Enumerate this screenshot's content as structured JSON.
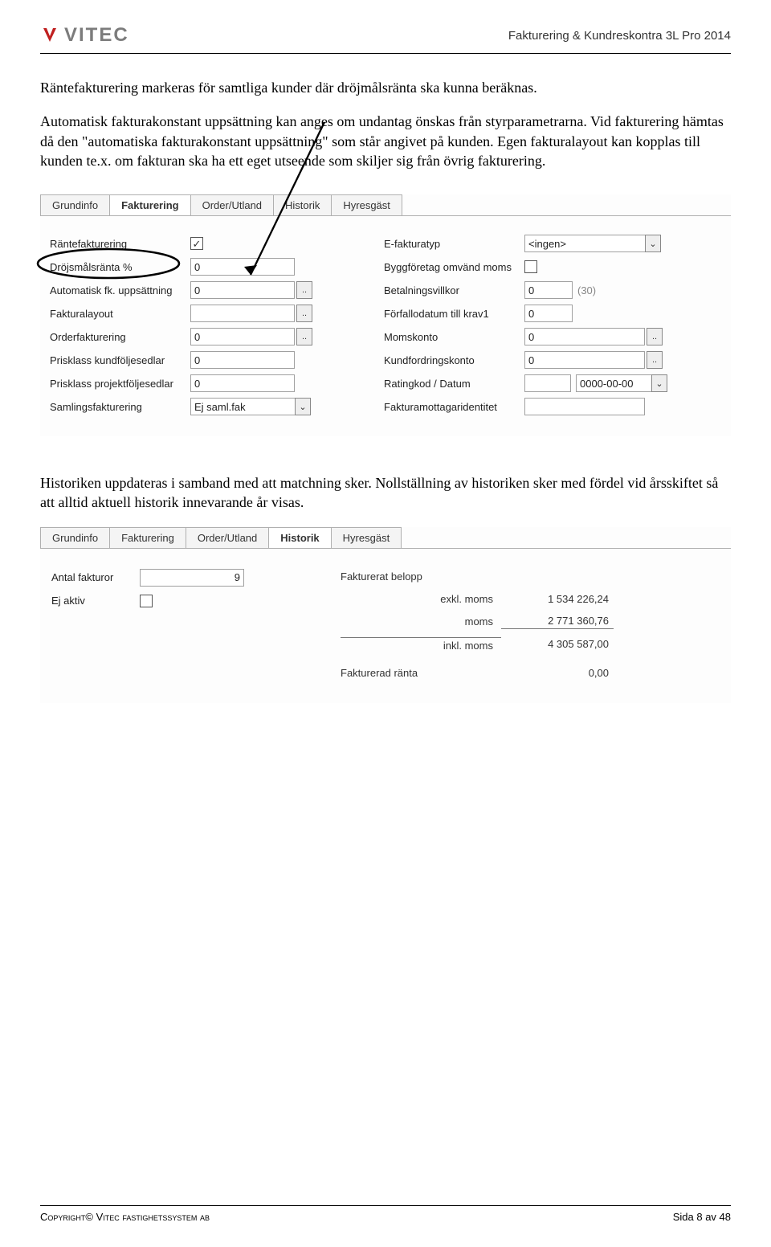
{
  "header": {
    "logo_text": "VITEC",
    "doc_title": "Fakturering & Kundreskontra 3L Pro 2014"
  },
  "para1": "Räntefakturering markeras för samtliga kunder där dröjmålsränta ska kunna beräknas.",
  "para2": "Automatisk fakturakonstant uppsättning kan anges om undantag önskas från styrparametrarna. Vid fakturering hämtas då den \"automatiska fakturakonstant uppsättning\" som står angivet på kunden. Egen fakturalayout kan kopplas till kunden te.x. om fakturan ska ha ett eget utseende som skiljer sig från övrig fakturering.",
  "shot1": {
    "tabs": [
      "Grundinfo",
      "Fakturering",
      "Order/Utland",
      "Historik",
      "Hyresgäst"
    ],
    "active_tab": 1,
    "left": {
      "rantefakt_label": "Räntefakturering",
      "rantefakt_checked": "✓",
      "drojs_label": "Dröjsmålsränta %",
      "drojs_val": "0",
      "autofk_label": "Automatisk fk. uppsättning",
      "autofk_val": "0",
      "faklay_label": "Fakturalayout",
      "faklay_val": "",
      "orderfk_label": "Orderfakturering",
      "orderfk_val": "0",
      "prisk_kund_label": "Prisklass kundföljesedlar",
      "prisk_kund_val": "0",
      "prisk_proj_label": "Prisklass projektföljesedlar",
      "prisk_proj_val": "0",
      "saml_label": "Samlingsfakturering",
      "saml_val": "Ej saml.fak"
    },
    "right": {
      "efakt_label": "E-fakturatyp",
      "efakt_val": "<ingen>",
      "bygg_label": "Byggföretag omvänd moms",
      "bygg_checked": "",
      "betv_label": "Betalningsvillkor",
      "betv_val": "0",
      "betv_hint": "(30)",
      "forf_label": "Förfallodatum till krav1",
      "forf_val": "0",
      "momsk_label": "Momskonto",
      "momsk_val": "0",
      "kfordr_label": "Kundfordringskonto",
      "kfordr_val": "0",
      "rating_label": "Ratingkod / Datum",
      "rating_val": "",
      "rating_date": "0000-00-00",
      "fmott_label": "Fakturamottagaridentitet",
      "fmott_val": ""
    }
  },
  "para3": "Historiken uppdateras i samband med att matchning sker. Nollställning av historiken sker med fördel vid årsskiftet så att alltid aktuell historik innevarande år visas.",
  "shot2": {
    "tabs": [
      "Grundinfo",
      "Fakturering",
      "Order/Utland",
      "Historik",
      "Hyresgäst"
    ],
    "active_tab": 3,
    "left": {
      "antal_label": "Antal fakturor",
      "antal_val": "9",
      "ejaktiv_label": "Ej aktiv",
      "ejaktiv_checked": ""
    },
    "right": {
      "faktbel_label": "Fakturerat belopp",
      "exkl_label": "exkl. moms",
      "exkl_val": "1 534 226,24",
      "moms_label": "moms",
      "moms_val": "2 771 360,76",
      "inkl_label": "inkl. moms",
      "inkl_val": "4 305 587,00",
      "ranta_label": "Fakturerad ränta",
      "ranta_val": "0,00"
    }
  },
  "footer": {
    "copyright": "Copyright© Vitec fastighetssystem ab",
    "page": "Sida 8 av 48"
  }
}
